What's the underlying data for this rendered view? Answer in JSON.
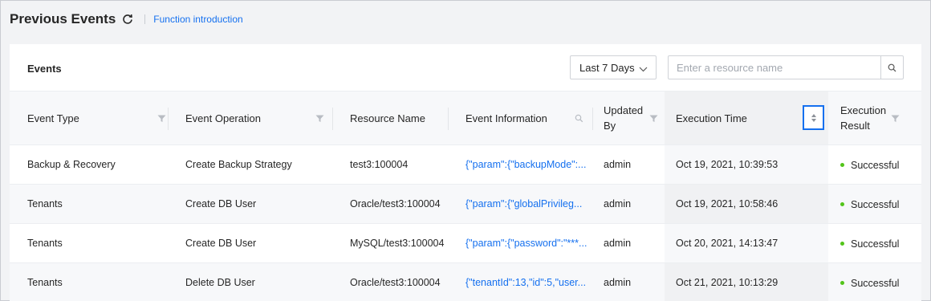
{
  "header": {
    "title": "Previous Events",
    "function_intro_link": "Function introduction"
  },
  "card": {
    "title": "Events",
    "time_range": {
      "selected": "Last 7 Days"
    },
    "search": {
      "placeholder": "Enter a resource name",
      "value": ""
    }
  },
  "table": {
    "columns": {
      "event_type": "Event Type",
      "event_operation": "Event Operation",
      "resource_name": "Resource Name",
      "event_information": "Event Information",
      "updated_by": "Updated By",
      "execution_time": "Execution Time",
      "execution_result": "Execution Result"
    },
    "rows": [
      {
        "event_type": "Backup & Recovery",
        "event_operation": "Create Backup Strategy",
        "resource_name": "test3:100004",
        "event_information": "{\"param\":{\"backupMode\":...",
        "updated_by": "admin",
        "execution_time": "Oct 19, 2021, 10:39:53",
        "execution_result": "Successful"
      },
      {
        "event_type": "Tenants",
        "event_operation": "Create DB User",
        "resource_name": "Oracle/test3:100004",
        "event_information": "{\"param\":{\"globalPrivileg...",
        "updated_by": "admin",
        "execution_time": "Oct 19, 2021, 10:58:46",
        "execution_result": "Successful"
      },
      {
        "event_type": "Tenants",
        "event_operation": "Create DB User",
        "resource_name": "MySQL/test3:100004",
        "event_information": "{\"param\":{\"password\":\"***...",
        "updated_by": "admin",
        "execution_time": "Oct 20, 2021, 14:13:47",
        "execution_result": "Successful"
      },
      {
        "event_type": "Tenants",
        "event_operation": "Delete DB User",
        "resource_name": "Oracle/test3:100004",
        "event_information": "{\"tenantId\":13,\"id\":5,\"user...",
        "updated_by": "admin",
        "execution_time": "Oct 21, 2021, 10:13:29",
        "execution_result": "Successful"
      }
    ]
  },
  "icons": {
    "refresh": "refresh-icon",
    "dropdown": "chevron-down-icon",
    "search": "search-icon",
    "filter": "filter-icon",
    "sort": "sort-icon",
    "status": "status-dot"
  },
  "colors": {
    "accent": "#1570ef",
    "success": "#52c41a",
    "page_bg": "#f2f3f5"
  }
}
